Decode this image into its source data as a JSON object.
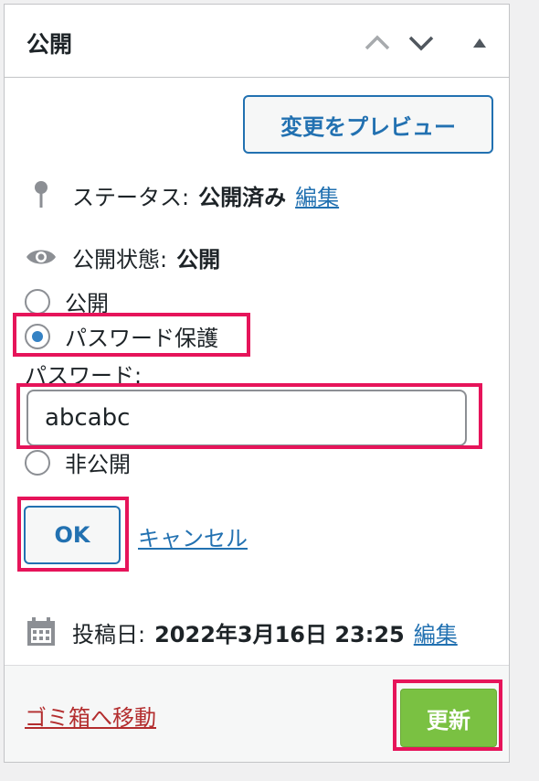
{
  "header": {
    "title": "公開"
  },
  "preview_button": "変更をプレビュー",
  "status": {
    "label": "ステータス:",
    "value": "公開済み",
    "edit": "編集"
  },
  "visibility": {
    "label": "公開状態:",
    "value": "公開",
    "options": [
      "公開",
      "パスワード保護",
      "非公開"
    ],
    "selected": "パスワード保護",
    "password_label": "パスワード:",
    "password_value": "abcabc",
    "ok_label": "OK",
    "cancel_label": "キャンセル"
  },
  "published": {
    "label": "投稿日:",
    "value": "2022年3月16日 23:25",
    "edit": "編集"
  },
  "footer": {
    "trash_label": "ゴミ箱へ移動",
    "update_label": "更新"
  },
  "icons": [
    "chevron-up-icon",
    "chevron-down-icon",
    "triangle-up-icon",
    "pin-icon",
    "eye-icon",
    "calendar-icon"
  ],
  "colors": {
    "accent": "#2271b1",
    "update_button": "#7ac142",
    "highlight": "#e6145a",
    "trash_link": "#b32d2e"
  }
}
